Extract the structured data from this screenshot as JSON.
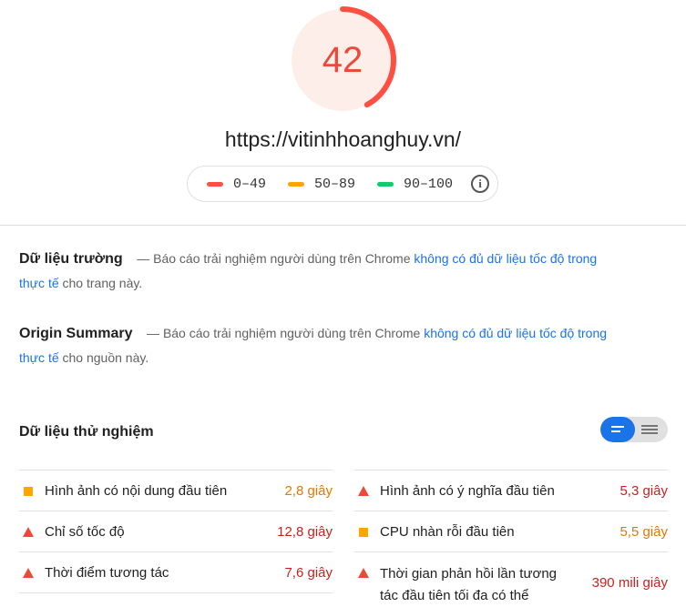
{
  "score": {
    "value": "42",
    "fraction": 0.42
  },
  "url": "https://vitinhhoanghuy.vn/",
  "legend": [
    {
      "label": "0–49",
      "color": "#ff4e42"
    },
    {
      "label": "50–89",
      "color": "#ffa400"
    },
    {
      "label": "90–100",
      "color": "#0cce6b"
    }
  ],
  "field_data": {
    "title": "Dữ liệu trường",
    "dash": "—",
    "text_before": "Báo cáo trải nghiệm người dùng trên Chrome ",
    "link": "không có đủ dữ liệu tốc độ trong thực tế",
    "text_after": " cho trang này."
  },
  "origin_summary": {
    "title": "Origin Summary",
    "dash": "—",
    "text_before": "Báo cáo trải nghiệm người dùng trên Chrome ",
    "link": "không có đủ dữ liệu tốc độ trong thực tế",
    "text_after": " cho nguồn này."
  },
  "lab_data": {
    "title": "Dữ liệu thử nghiệm",
    "left": [
      {
        "name": "Hình ảnh có nội dung đầu tiên",
        "value": "2,8 giây",
        "status": "average"
      },
      {
        "name": "Chỉ số tốc độ",
        "value": "12,8 giây",
        "status": "fail"
      },
      {
        "name": "Thời điểm tương tác",
        "value": "7,6 giây",
        "status": "fail"
      }
    ],
    "right": [
      {
        "name": "Hình ảnh có ý nghĩa đầu tiên",
        "value": "5,3 giây",
        "status": "fail"
      },
      {
        "name": "CPU nhàn rỗi đầu tiên",
        "value": "5,5 giây",
        "status": "fail"
      },
      {
        "name": "Thời gian phản hồi lần tương tác đầu tiên tối đa có thể",
        "value": "390 mili giây",
        "status": "fail"
      }
    ]
  },
  "colors": {
    "fail": "#eb4a3a",
    "average": "#ffa400",
    "link": "#1a73e8"
  }
}
